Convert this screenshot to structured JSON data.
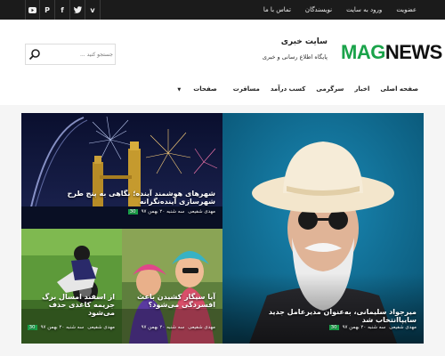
{
  "topbar": {
    "social_icons": [
      "youtube-icon",
      "pinterest-icon",
      "facebook-icon",
      "twitter-icon",
      "vimeo-icon"
    ],
    "social_glyphs": [
      "▶",
      "P",
      "f",
      "t",
      "v"
    ],
    "links": [
      "عضویت",
      "ورود به سایت",
      "نویسندگان",
      "تماس با ما"
    ]
  },
  "header": {
    "logo_part1": "MAG",
    "logo_part2": "NEWS",
    "site_title": "سایت خبری",
    "site_tagline": "پایگاه اطلاع رسانی و خبری",
    "search_placeholder": "جستجو کنید ...",
    "nav": [
      "صفحه اصلی",
      "اخبار",
      "سرگرمی",
      "کسب درآمد",
      "مسافرت",
      "صفحات"
    ]
  },
  "posts": [
    {
      "title": "میرجواد سلیمانی، به‌عنوان مدیرعامل جدید سایپاانتخاب شد",
      "author": "مهدی شفیعی",
      "date": "سه شنبه ۲۰ بهمن ۹۷",
      "count": "30"
    },
    {
      "title": "شهرهای هوشمند آینده؛ نگاهی به پنج طرح شهرسازی آینده‌نگرانه",
      "author": "مهدی شفیعی",
      "date": "سه شنبه ۲۰ بهمن ۹۷",
      "count": "30"
    },
    {
      "title": "آیا سیگار کشیدن باعث افسردگی می‌شود؟",
      "author": "مهدی شفیعی",
      "date": "سه شنبه ۲۰ بهمن ۹۷",
      "count": "30"
    },
    {
      "title": "از اسفند امسال برگ جریمه کاغذی حذف می‌شود",
      "author": "مهدی شفیعی",
      "date": "سه شنبه ۲۰ بهمن ۹۷",
      "count": "30"
    }
  ],
  "colors": {
    "accent": "#1aa34a",
    "topbar": "#1b1b1b"
  }
}
